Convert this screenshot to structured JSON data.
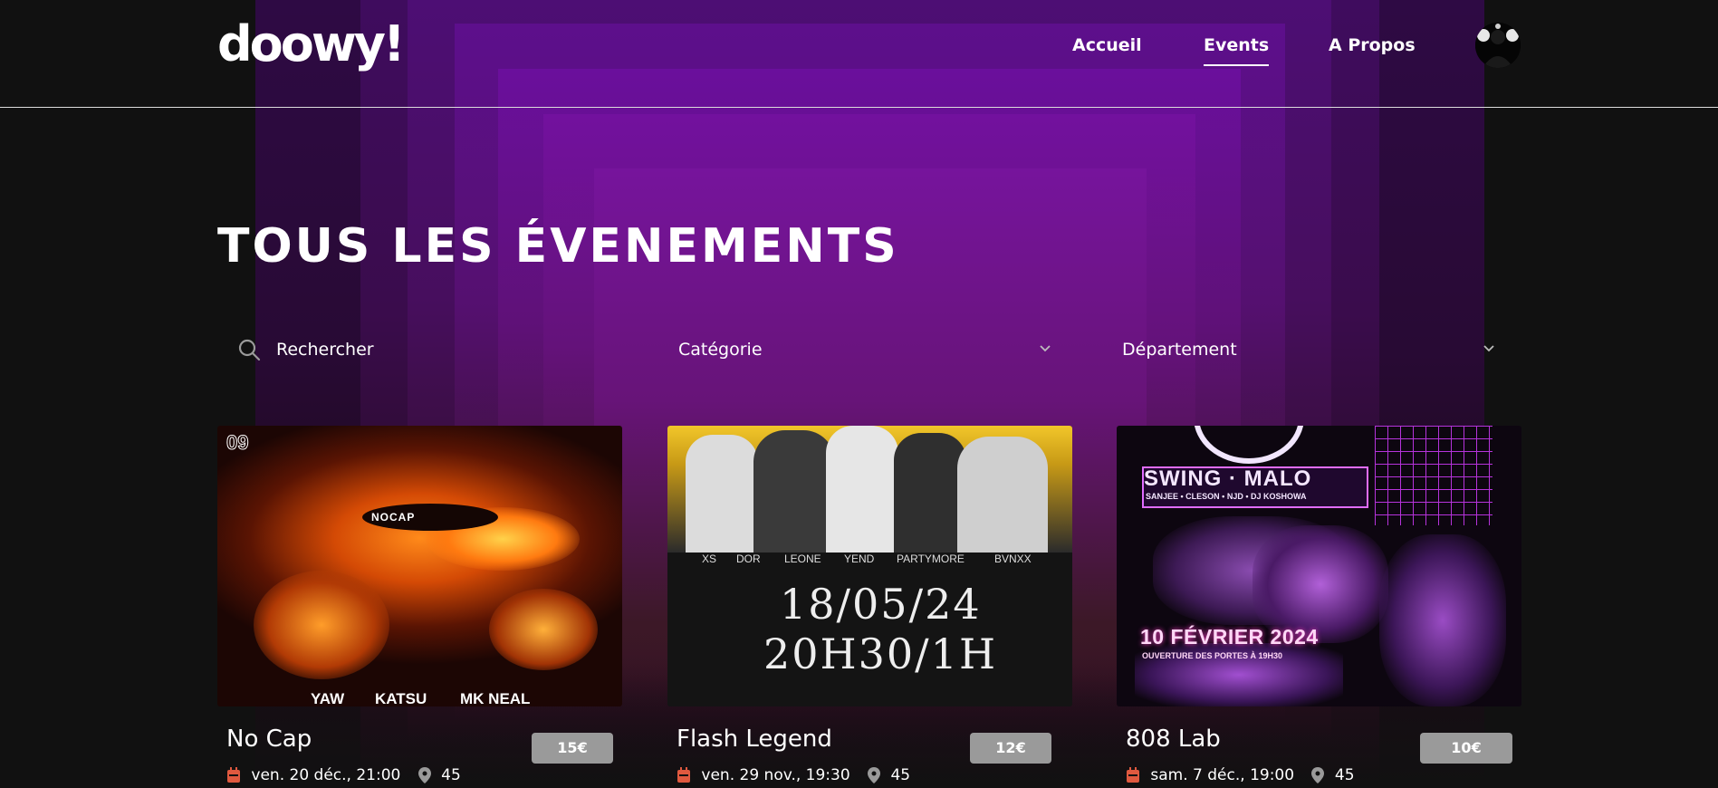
{
  "brand": {
    "logo_text": "doowy!"
  },
  "nav": {
    "items": [
      {
        "label": "Accueil"
      },
      {
        "label": "Events"
      },
      {
        "label": "A Propos"
      }
    ]
  },
  "page": {
    "title": "TOUS LES ÉVENEMENTS"
  },
  "filters": {
    "search_placeholder": "Rechercher",
    "category_label": "Catégorie",
    "department_label": "Département"
  },
  "events": [
    {
      "name": "No Cap",
      "price": "15€",
      "date": "ven. 20 déc., 21:00",
      "department": "45",
      "poster": {
        "corner": "09",
        "logo": "NOCAP",
        "artists": [
          "YAW",
          "KATSU",
          "MK NEAL"
        ]
      }
    },
    {
      "name": "Flash Legend",
      "price": "12€",
      "date": "ven. 29 nov., 19:30",
      "department": "45",
      "poster": {
        "artists": [
          "XS",
          "DOR",
          "LEONE",
          "YEND",
          "PARTYMORE",
          "BVNXX"
        ],
        "line1": "18/05/24",
        "line2": "20H30/1H"
      }
    },
    {
      "name": "808 Lab",
      "price": "10€",
      "date": "sam. 7 déc., 19:00",
      "department": "45",
      "poster": {
        "headline": "SWING · MALO",
        "lineup": "SANJEE • CLESON • NJD • DJ KOSHOWA",
        "date": "10 FÉVRIER 2024",
        "subline": "OUVERTURE DES PORTES À 19H30"
      }
    }
  ],
  "icons": {
    "search": "search-icon",
    "chevron": "chevron-down-icon",
    "calendar": "calendar-icon",
    "location": "location-pin-icon"
  },
  "colors": {
    "background": "#111111",
    "glow": "#6a0f96",
    "price_badge": "#9a9a9a",
    "calendar_icon": "#e0593f"
  }
}
